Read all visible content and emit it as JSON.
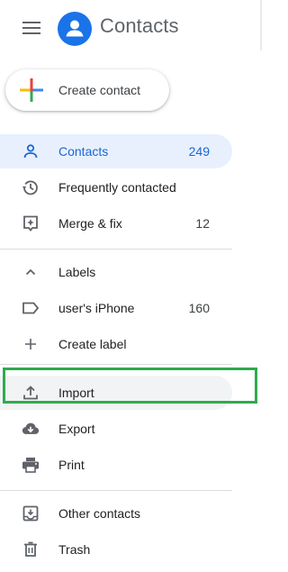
{
  "app": {
    "title": "Contacts",
    "menu_icon": "hamburger-menu-icon",
    "logo_icon": "contacts-person-icon",
    "brand_color": "#1a73e8"
  },
  "create_button": {
    "label": "Create contact",
    "icon": "google-plus-icon"
  },
  "nav": {
    "contacts": {
      "label": "Contacts",
      "count": "249",
      "icon": "person-icon",
      "active": true
    },
    "frequently_contacted": {
      "label": "Frequently contacted",
      "icon": "history-icon"
    },
    "merge_fix": {
      "label": "Merge & fix",
      "count": "12",
      "icon": "merge-sparkle-icon"
    }
  },
  "labels_section": {
    "header": {
      "label": "Labels",
      "icon": "chevron-up-icon"
    },
    "items": [
      {
        "label": "user's iPhone",
        "count": "160",
        "icon": "label-tag-icon"
      }
    ],
    "create": {
      "label": "Create label",
      "icon": "plus-icon"
    }
  },
  "actions": {
    "import": {
      "label": "Import",
      "icon": "upload-icon",
      "highlighted": true
    },
    "export": {
      "label": "Export",
      "icon": "cloud-download-icon"
    },
    "print": {
      "label": "Print",
      "icon": "printer-icon"
    }
  },
  "other": {
    "other_contacts": {
      "label": "Other contacts",
      "icon": "archive-download-icon"
    },
    "trash": {
      "label": "Trash",
      "icon": "trash-icon"
    }
  },
  "colors": {
    "active_bg": "#e8f0fe",
    "active_text": "#1967d2",
    "highlight_border": "#2eab4f",
    "hover_bg": "#f1f3f4"
  }
}
